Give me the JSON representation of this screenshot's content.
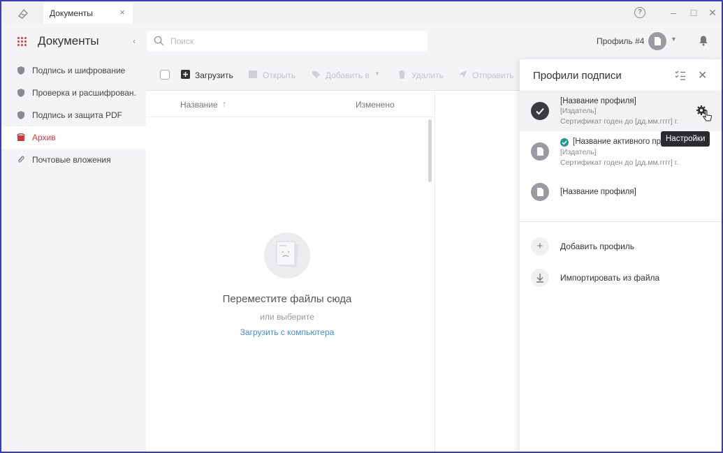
{
  "titlebar": {
    "tab_label": "Документы",
    "tab_close": "×",
    "help": "?",
    "minimize": "–",
    "maximize": "□",
    "close": "✕"
  },
  "header": {
    "title": "Документы",
    "collapse": "‹",
    "search_placeholder": "Поиск",
    "profile_label": "Профиль #4",
    "profile_caret": "▼"
  },
  "sidebar": {
    "items": [
      {
        "label": "Подпись и шифрование",
        "icon": "shield-icon"
      },
      {
        "label": "Проверка и расшифрован...",
        "icon": "shield-check-icon"
      },
      {
        "label": "Подпись и защита PDF",
        "icon": "pdf-shield-icon"
      },
      {
        "label": "Архив",
        "icon": "archive-icon",
        "active": true
      },
      {
        "label": "Почтовые вложения",
        "icon": "paperclip-icon"
      }
    ]
  },
  "toolbar": {
    "upload": "Загрузить",
    "open": "Открыть",
    "add_to": "Добавить в",
    "delete": "Удалить",
    "send": "Отправить"
  },
  "table": {
    "col_name": "Название",
    "sort": "↑",
    "col_changed": "Изменено"
  },
  "empty": {
    "title": "Переместите файлы сюда",
    "subtitle": "или выберите",
    "link": "Загрузить с компьютера"
  },
  "panel": {
    "title": "Профили подписи",
    "close": "✕",
    "profiles": [
      {
        "name": "[Название профиля]",
        "publisher": "[Издатель]",
        "cert": "Сертификат годен до [дд.мм.гггг] г."
      },
      {
        "name": "[Название активного про",
        "publisher": "[Издатель]",
        "cert": "Сертификат годен до [дд.мм.гггг] г."
      },
      {
        "name": "[Название профиля]"
      }
    ],
    "tooltip": "Настройки",
    "add_profile": "Добавить профиль",
    "import_file": "Импортировать из файла",
    "add_symbol": "+"
  },
  "colors": {
    "accent_red": "#d33a3f",
    "link_blue": "#3d8fd6",
    "active_green": "#27998a",
    "frame": "#3b3bb5"
  }
}
